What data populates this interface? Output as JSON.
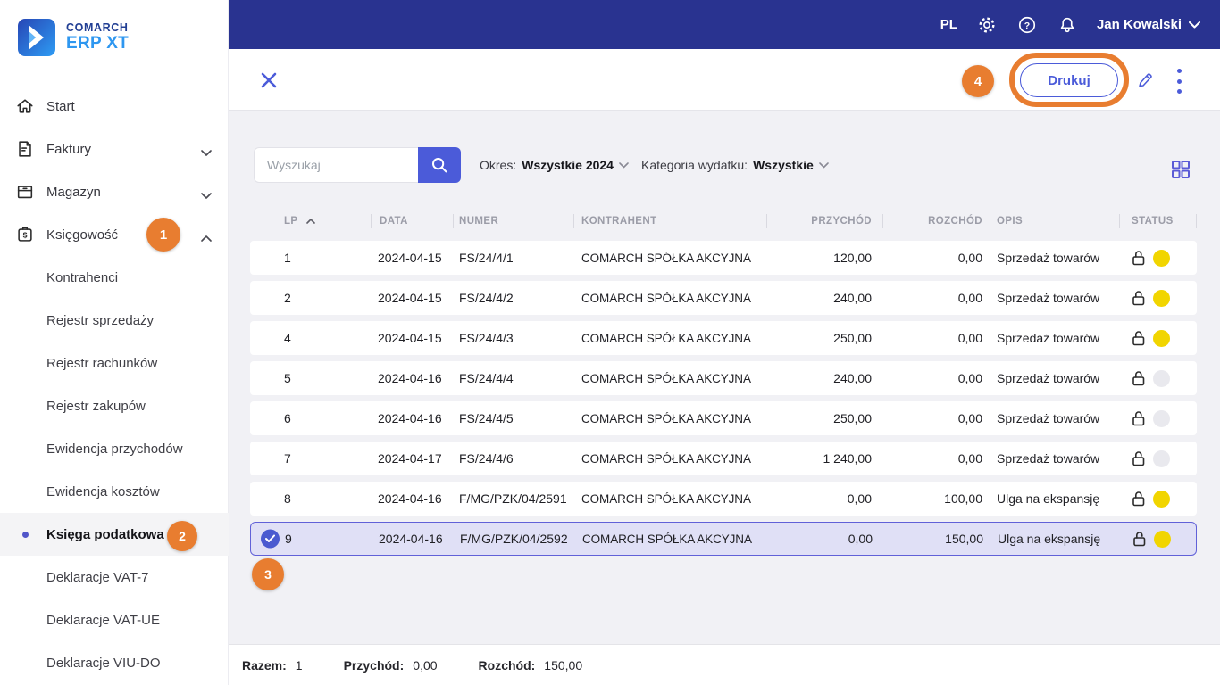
{
  "topbar": {
    "language": "PL",
    "user_name": "Jan Kowalski"
  },
  "logo": {
    "brand": "COMARCH",
    "product": "ERP XT"
  },
  "sidebar": {
    "items": [
      {
        "label": "Start",
        "icon": "home-icon",
        "type": "main"
      },
      {
        "label": "Faktury",
        "icon": "invoice-icon",
        "type": "main",
        "chevron": "down"
      },
      {
        "label": "Magazyn",
        "icon": "warehouse-icon",
        "type": "main",
        "chevron": "down"
      },
      {
        "label": "Księgowość",
        "icon": "accounting-icon",
        "type": "main",
        "chevron": "up"
      },
      {
        "label": "Kontrahenci",
        "type": "sub"
      },
      {
        "label": "Rejestr sprzedaży",
        "type": "sub"
      },
      {
        "label": "Rejestr rachunków",
        "type": "sub"
      },
      {
        "label": "Rejestr zakupów",
        "type": "sub"
      },
      {
        "label": "Ewidencja przychodów",
        "type": "sub"
      },
      {
        "label": "Ewidencja kosztów",
        "type": "sub"
      },
      {
        "label": "Księga podatkowa",
        "type": "sub",
        "active": true
      },
      {
        "label": "Deklaracje VAT-7",
        "type": "sub"
      },
      {
        "label": "Deklaracje VAT-UE",
        "type": "sub"
      },
      {
        "label": "Deklaracje VIU-DO",
        "type": "sub"
      }
    ]
  },
  "toolbar": {
    "print_button": "Drukuj"
  },
  "filters": {
    "search_placeholder": "Wyszukaj",
    "okres_label": "Okres:",
    "okres_value": "Wszystkie 2024",
    "kategoria_label": "Kategoria wydatku:",
    "kategoria_value": "Wszystkie"
  },
  "table": {
    "headers": [
      "LP",
      "DATA",
      "NUMER",
      "KONTRAHENT",
      "PRZYCHÓD",
      "ROZCHÓD",
      "OPIS",
      "STATUS"
    ],
    "rows": [
      {
        "lp": "1",
        "data": "2024-04-15",
        "numer": "FS/24/4/1",
        "kontrahent": "COMARCH SPÓŁKA AKCYJNA",
        "przychod": "120,00",
        "rozchod": "0,00",
        "opis": "Sprzedaż towarów",
        "status": "yellow",
        "selected": false
      },
      {
        "lp": "2",
        "data": "2024-04-15",
        "numer": "FS/24/4/2",
        "kontrahent": "COMARCH SPÓŁKA AKCYJNA",
        "przychod": "240,00",
        "rozchod": "0,00",
        "opis": "Sprzedaż towarów",
        "status": "yellow",
        "selected": false
      },
      {
        "lp": "4",
        "data": "2024-04-15",
        "numer": "FS/24/4/3",
        "kontrahent": "COMARCH SPÓŁKA AKCYJNA",
        "przychod": "250,00",
        "rozchod": "0,00",
        "opis": "Sprzedaż towarów",
        "status": "yellow",
        "selected": false
      },
      {
        "lp": "5",
        "data": "2024-04-16",
        "numer": "FS/24/4/4",
        "kontrahent": "COMARCH SPÓŁKA AKCYJNA",
        "przychod": "240,00",
        "rozchod": "0,00",
        "opis": "Sprzedaż towarów",
        "status": "gray",
        "selected": false
      },
      {
        "lp": "6",
        "data": "2024-04-16",
        "numer": "FS/24/4/5",
        "kontrahent": "COMARCH SPÓŁKA AKCYJNA",
        "przychod": "250,00",
        "rozchod": "0,00",
        "opis": "Sprzedaż towarów",
        "status": "gray",
        "selected": false
      },
      {
        "lp": "7",
        "data": "2024-04-17",
        "numer": "FS/24/4/6",
        "kontrahent": "COMARCH SPÓŁKA AKCYJNA",
        "przychod": "1 240,00",
        "rozchod": "0,00",
        "opis": "Sprzedaż towarów",
        "status": "gray",
        "selected": false
      },
      {
        "lp": "8",
        "data": "2024-04-16",
        "numer": "F/MG/PZK/04/2591",
        "kontrahent": "COMARCH SPÓŁKA AKCYJNA",
        "przychod": "0,00",
        "rozchod": "100,00",
        "opis": "Ulga na ekspansję",
        "status": "yellow",
        "selected": false
      },
      {
        "lp": "9",
        "data": "2024-04-16",
        "numer": "F/MG/PZK/04/2592",
        "kontrahent": "COMARCH SPÓŁKA AKCYJNA",
        "przychod": "0,00",
        "rozchod": "150,00",
        "opis": "Ulga na ekspansję",
        "status": "yellow",
        "selected": true
      }
    ]
  },
  "footer": {
    "razem_label": "Razem:",
    "razem_value": "1",
    "przychod_label": "Przychód:",
    "przychod_value": "0,00",
    "rozchod_label": "Rozchód:",
    "rozchod_value": "150,00"
  },
  "annotations": {
    "step1": "1",
    "step2": "2",
    "step3": "3",
    "step4": "4"
  },
  "colors": {
    "topbar": "#293390",
    "accent": "#4b5bd9",
    "annotation_orange": "#e87d30",
    "status_yellow": "#f1d500",
    "status_gray": "#e9e9ee",
    "selected_row_bg": "#e0e0f6",
    "selected_row_border": "#6161d8"
  }
}
